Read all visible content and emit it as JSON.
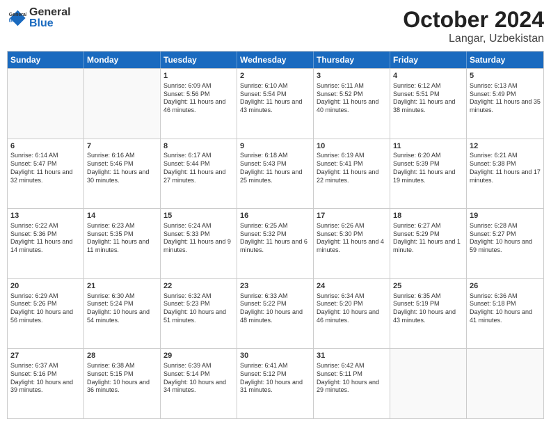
{
  "header": {
    "logo_general": "General",
    "logo_blue": "Blue",
    "month": "October 2024",
    "location": "Langar, Uzbekistan"
  },
  "weekdays": [
    "Sunday",
    "Monday",
    "Tuesday",
    "Wednesday",
    "Thursday",
    "Friday",
    "Saturday"
  ],
  "rows": [
    [
      {
        "day": "",
        "sunrise": "",
        "sunset": "",
        "daylight": ""
      },
      {
        "day": "",
        "sunrise": "",
        "sunset": "",
        "daylight": ""
      },
      {
        "day": "1",
        "sunrise": "Sunrise: 6:09 AM",
        "sunset": "Sunset: 5:56 PM",
        "daylight": "Daylight: 11 hours and 46 minutes."
      },
      {
        "day": "2",
        "sunrise": "Sunrise: 6:10 AM",
        "sunset": "Sunset: 5:54 PM",
        "daylight": "Daylight: 11 hours and 43 minutes."
      },
      {
        "day": "3",
        "sunrise": "Sunrise: 6:11 AM",
        "sunset": "Sunset: 5:52 PM",
        "daylight": "Daylight: 11 hours and 40 minutes."
      },
      {
        "day": "4",
        "sunrise": "Sunrise: 6:12 AM",
        "sunset": "Sunset: 5:51 PM",
        "daylight": "Daylight: 11 hours and 38 minutes."
      },
      {
        "day": "5",
        "sunrise": "Sunrise: 6:13 AM",
        "sunset": "Sunset: 5:49 PM",
        "daylight": "Daylight: 11 hours and 35 minutes."
      }
    ],
    [
      {
        "day": "6",
        "sunrise": "Sunrise: 6:14 AM",
        "sunset": "Sunset: 5:47 PM",
        "daylight": "Daylight: 11 hours and 32 minutes."
      },
      {
        "day": "7",
        "sunrise": "Sunrise: 6:16 AM",
        "sunset": "Sunset: 5:46 PM",
        "daylight": "Daylight: 11 hours and 30 minutes."
      },
      {
        "day": "8",
        "sunrise": "Sunrise: 6:17 AM",
        "sunset": "Sunset: 5:44 PM",
        "daylight": "Daylight: 11 hours and 27 minutes."
      },
      {
        "day": "9",
        "sunrise": "Sunrise: 6:18 AM",
        "sunset": "Sunset: 5:43 PM",
        "daylight": "Daylight: 11 hours and 25 minutes."
      },
      {
        "day": "10",
        "sunrise": "Sunrise: 6:19 AM",
        "sunset": "Sunset: 5:41 PM",
        "daylight": "Daylight: 11 hours and 22 minutes."
      },
      {
        "day": "11",
        "sunrise": "Sunrise: 6:20 AM",
        "sunset": "Sunset: 5:39 PM",
        "daylight": "Daylight: 11 hours and 19 minutes."
      },
      {
        "day": "12",
        "sunrise": "Sunrise: 6:21 AM",
        "sunset": "Sunset: 5:38 PM",
        "daylight": "Daylight: 11 hours and 17 minutes."
      }
    ],
    [
      {
        "day": "13",
        "sunrise": "Sunrise: 6:22 AM",
        "sunset": "Sunset: 5:36 PM",
        "daylight": "Daylight: 11 hours and 14 minutes."
      },
      {
        "day": "14",
        "sunrise": "Sunrise: 6:23 AM",
        "sunset": "Sunset: 5:35 PM",
        "daylight": "Daylight: 11 hours and 11 minutes."
      },
      {
        "day": "15",
        "sunrise": "Sunrise: 6:24 AM",
        "sunset": "Sunset: 5:33 PM",
        "daylight": "Daylight: 11 hours and 9 minutes."
      },
      {
        "day": "16",
        "sunrise": "Sunrise: 6:25 AM",
        "sunset": "Sunset: 5:32 PM",
        "daylight": "Daylight: 11 hours and 6 minutes."
      },
      {
        "day": "17",
        "sunrise": "Sunrise: 6:26 AM",
        "sunset": "Sunset: 5:30 PM",
        "daylight": "Daylight: 11 hours and 4 minutes."
      },
      {
        "day": "18",
        "sunrise": "Sunrise: 6:27 AM",
        "sunset": "Sunset: 5:29 PM",
        "daylight": "Daylight: 11 hours and 1 minute."
      },
      {
        "day": "19",
        "sunrise": "Sunrise: 6:28 AM",
        "sunset": "Sunset: 5:27 PM",
        "daylight": "Daylight: 10 hours and 59 minutes."
      }
    ],
    [
      {
        "day": "20",
        "sunrise": "Sunrise: 6:29 AM",
        "sunset": "Sunset: 5:26 PM",
        "daylight": "Daylight: 10 hours and 56 minutes."
      },
      {
        "day": "21",
        "sunrise": "Sunrise: 6:30 AM",
        "sunset": "Sunset: 5:24 PM",
        "daylight": "Daylight: 10 hours and 54 minutes."
      },
      {
        "day": "22",
        "sunrise": "Sunrise: 6:32 AM",
        "sunset": "Sunset: 5:23 PM",
        "daylight": "Daylight: 10 hours and 51 minutes."
      },
      {
        "day": "23",
        "sunrise": "Sunrise: 6:33 AM",
        "sunset": "Sunset: 5:22 PM",
        "daylight": "Daylight: 10 hours and 48 minutes."
      },
      {
        "day": "24",
        "sunrise": "Sunrise: 6:34 AM",
        "sunset": "Sunset: 5:20 PM",
        "daylight": "Daylight: 10 hours and 46 minutes."
      },
      {
        "day": "25",
        "sunrise": "Sunrise: 6:35 AM",
        "sunset": "Sunset: 5:19 PM",
        "daylight": "Daylight: 10 hours and 43 minutes."
      },
      {
        "day": "26",
        "sunrise": "Sunrise: 6:36 AM",
        "sunset": "Sunset: 5:18 PM",
        "daylight": "Daylight: 10 hours and 41 minutes."
      }
    ],
    [
      {
        "day": "27",
        "sunrise": "Sunrise: 6:37 AM",
        "sunset": "Sunset: 5:16 PM",
        "daylight": "Daylight: 10 hours and 39 minutes."
      },
      {
        "day": "28",
        "sunrise": "Sunrise: 6:38 AM",
        "sunset": "Sunset: 5:15 PM",
        "daylight": "Daylight: 10 hours and 36 minutes."
      },
      {
        "day": "29",
        "sunrise": "Sunrise: 6:39 AM",
        "sunset": "Sunset: 5:14 PM",
        "daylight": "Daylight: 10 hours and 34 minutes."
      },
      {
        "day": "30",
        "sunrise": "Sunrise: 6:41 AM",
        "sunset": "Sunset: 5:12 PM",
        "daylight": "Daylight: 10 hours and 31 minutes."
      },
      {
        "day": "31",
        "sunrise": "Sunrise: 6:42 AM",
        "sunset": "Sunset: 5:11 PM",
        "daylight": "Daylight: 10 hours and 29 minutes."
      },
      {
        "day": "",
        "sunrise": "",
        "sunset": "",
        "daylight": ""
      },
      {
        "day": "",
        "sunrise": "",
        "sunset": "",
        "daylight": ""
      }
    ]
  ]
}
